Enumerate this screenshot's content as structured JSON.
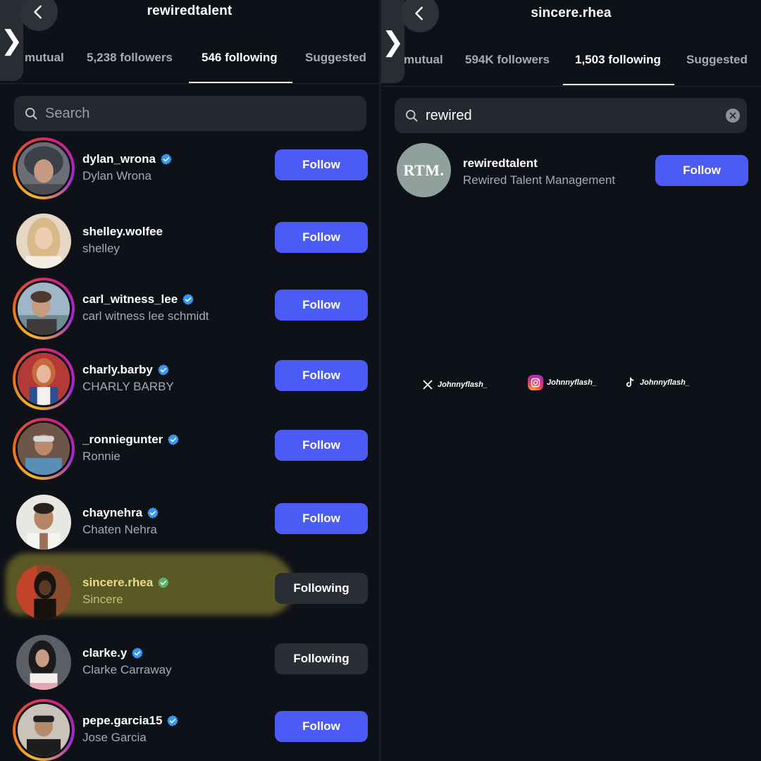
{
  "left": {
    "title": "rewiredtalent",
    "tabs": [
      {
        "label": "mutual"
      },
      {
        "label": "5,238 followers"
      },
      {
        "label": "546 following"
      },
      {
        "label": "Suggested"
      }
    ],
    "search": {
      "placeholder": "Search",
      "value": ""
    },
    "rows": [
      {
        "username": "dylan_wrona",
        "fullname": "Dylan Wrona",
        "verified": true,
        "button": "Follow"
      },
      {
        "username": "shelley.wolfee",
        "fullname": "shelley",
        "verified": false,
        "button": "Follow"
      },
      {
        "username": "carl_witness_lee",
        "fullname": "carl witness lee schmidt",
        "verified": true,
        "button": "Follow"
      },
      {
        "username": "charly.barby",
        "fullname": "CHARLY BARBY",
        "verified": true,
        "button": "Follow"
      },
      {
        "username": "_ronniegunter",
        "fullname": "Ronnie",
        "verified": true,
        "button": "Follow"
      },
      {
        "username": "chaynehra",
        "fullname": "Chaten Nehra",
        "verified": true,
        "button": "Follow"
      },
      {
        "username": "sincere.rhea",
        "fullname": "Sincere",
        "verified": true,
        "button": "Following"
      },
      {
        "username": "clarke.y",
        "fullname": "Clarke Carraway",
        "verified": true,
        "button": "Following"
      },
      {
        "username": "pepe.garcia15",
        "fullname": "Jose Garcia",
        "verified": true,
        "button": "Follow"
      }
    ]
  },
  "right": {
    "title": "sincere.rhea",
    "tabs": [
      {
        "label": "mutual"
      },
      {
        "label": "594K followers"
      },
      {
        "label": "1,503 following"
      },
      {
        "label": "Suggested"
      }
    ],
    "search": {
      "placeholder": "Search",
      "value": "rewired"
    },
    "result": {
      "avatar_text": "RTM.",
      "username": "rewiredtalent",
      "fullname": "Rewired Talent Management",
      "button": "Follow"
    },
    "watermarks": [
      {
        "icon": "x-logo-icon",
        "label": "Johnnyflash_"
      },
      {
        "icon": "instagram-logo-icon",
        "label": "Johnnyflash_"
      },
      {
        "icon": "tiktok-logo-icon",
        "label": "Johnnyflash_"
      }
    ]
  },
  "colors": {
    "background": "#0f1118",
    "follow_button": "#4a5cf5",
    "following_button": "#2c2e36",
    "verified_badge": "#3897f0",
    "highlight": "#d6cc3c"
  }
}
